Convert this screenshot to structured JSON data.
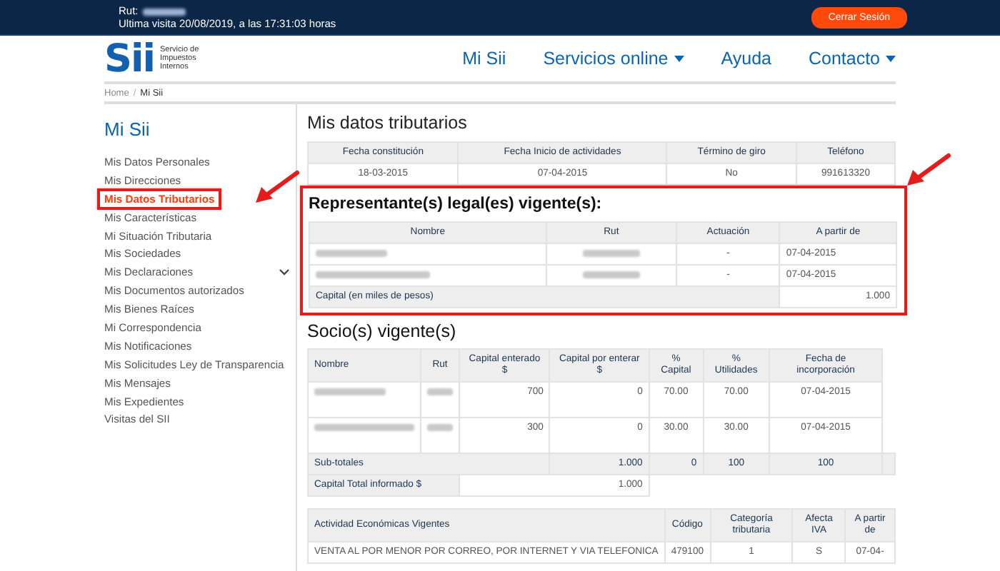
{
  "top_bar": {
    "rut_label": "Rut:",
    "last_visit": "Ultima visita 20/08/2019, a las 17:31:03 horas",
    "logout_button": "Cerrar Sesión"
  },
  "logo": {
    "mark": "Sii",
    "lines": [
      "Servicio de",
      "Impuestos",
      "Internos"
    ]
  },
  "nav": [
    {
      "label": "Mi Sii",
      "dropdown": false
    },
    {
      "label": "Servicios online",
      "dropdown": true
    },
    {
      "label": "Ayuda",
      "dropdown": false
    },
    {
      "label": "Contacto",
      "dropdown": true
    }
  ],
  "breadcrumb": {
    "separator": "/",
    "items": [
      {
        "label": "Home",
        "current": false
      },
      {
        "label": "Mi Sii",
        "current": true
      }
    ]
  },
  "sidebar": {
    "title": "Mi Sii",
    "items": [
      {
        "label": "Mis Datos Personales",
        "selected": false,
        "annotated": false,
        "expandable": false
      },
      {
        "label": "Mis Direcciones",
        "selected": false,
        "annotated": false,
        "expandable": false
      },
      {
        "label": "Mis Datos Tributarios",
        "selected": true,
        "annotated": true,
        "expandable": false
      },
      {
        "label": "Mis Características",
        "selected": false,
        "annotated": false,
        "expandable": false
      },
      {
        "label": "Mi Situación Tributaria",
        "selected": false,
        "annotated": false,
        "expandable": false
      },
      {
        "label": "Mis Sociedades",
        "selected": false,
        "annotated": false,
        "expandable": false
      },
      {
        "label": "Mis Declaraciones",
        "selected": false,
        "annotated": false,
        "expandable": true
      },
      {
        "label": "Mis Documentos autorizados",
        "selected": false,
        "annotated": false,
        "expandable": false
      },
      {
        "label": "Mis Bienes Raíces",
        "selected": false,
        "annotated": false,
        "expandable": false
      },
      {
        "label": "Mi Correspondencia",
        "selected": false,
        "annotated": false,
        "expandable": false
      },
      {
        "label": "Mis Notificaciones",
        "selected": false,
        "annotated": false,
        "expandable": false
      },
      {
        "label": "Mis Solicitudes Ley de Transparencia",
        "selected": false,
        "annotated": false,
        "expandable": false
      },
      {
        "label": "Mis Mensajes",
        "selected": false,
        "annotated": false,
        "expandable": false
      },
      {
        "label": "Mis Expedientes",
        "selected": false,
        "annotated": false,
        "expandable": false
      },
      {
        "label": "Visitas del SII",
        "selected": false,
        "annotated": false,
        "expandable": false
      }
    ]
  },
  "main": {
    "title": "Mis datos tributarios",
    "general_table": {
      "columns": [
        "Fecha constitución",
        "Fecha Inicio de actividades",
        "Término de giro",
        "Teléfono"
      ],
      "rows": [
        [
          "18-03-2015",
          "07-04-2015",
          "No",
          "991613320"
        ]
      ]
    },
    "representatives": {
      "annotated": true,
      "title": "Representante(s) legal(es) vigente(s):",
      "columns": [
        "Nombre",
        "Rut",
        "Actuación",
        "A partir de"
      ],
      "rows": [
        [
          null,
          null,
          "-",
          "07-04-2015"
        ],
        [
          null,
          null,
          "-",
          "07-04-2015"
        ]
      ],
      "capital_label": "Capital (en miles de pesos)",
      "capital_value": "1.000"
    },
    "partners": {
      "title": "Socio(s) vigente(s)",
      "columns": [
        "Nombre",
        "Rut",
        "Capital enterado $",
        "Capital por enterar $",
        "% Capital",
        "% Utilidades",
        "Fecha de incorporación"
      ],
      "rows": [
        [
          null,
          null,
          "700",
          "0",
          "70.00",
          "70.00",
          "07-04-2015"
        ],
        [
          null,
          null,
          "300",
          "0",
          "30.00",
          "30.00",
          "07-04-2015"
        ]
      ],
      "subtotals": {
        "label": "Sub-totales",
        "values": [
          "1.000",
          "0",
          "100",
          "100"
        ]
      },
      "total": {
        "label": "Capital Total informado $",
        "value": "1.000"
      }
    },
    "activities": {
      "columns": [
        "Actividad Económicas Vigentes",
        "Código",
        "Categoría tributaria",
        "Afecta IVA",
        "A partir de"
      ],
      "rows": [
        [
          "VENTA AL POR MENOR POR CORREO, POR INTERNET Y VIA TELEFONICA",
          "479100",
          "1",
          "S",
          "07-04-"
        ]
      ]
    }
  }
}
